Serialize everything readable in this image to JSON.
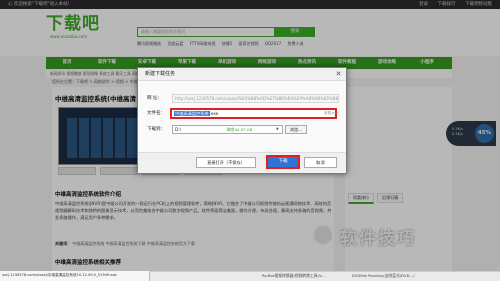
{
  "topbar": {
    "welcome": "心 欢迎搜索\"下载吧\"进入本站！",
    "links": [
      "登录",
      "下载排行",
      "下载吧移动版"
    ]
  },
  "logo": {
    "cn": "下载吧",
    "en": "www.xiazaiba.com"
  },
  "search": {
    "placeholder": "请输入需要搜索的关键词",
    "button": "搜索"
  },
  "hotwords": [
    "腾讯视频播放",
    "百度云盘",
    "FTTV网络电视",
    "快播5",
    "爱奇艺视频",
    "QQ2017",
    "免费小说"
  ],
  "nav": [
    "首页",
    "软件下载",
    "安卓下载",
    "苹果下载",
    "单机游戏",
    "网络游戏",
    "热点资讯",
    "软件教程",
    "游戏攻略",
    "小程序"
  ],
  "subnav": "新闻资讯  视频播放  图形图像  系统工具  聊天工具  网络工具  安全相关  游戏娱乐  手机软件",
  "breadcrumb": "您所在位置：下载吧 > 网络软件 > 视频 > 中维高清监控系统",
  "page": {
    "title": "中维高清监控系统(中维高清",
    "intro_heading": "中维高清监控系统软件介绍",
    "intro_text": "中维高清监控系统(JNVR)是中维公司开发的一款运行在PC机上的视频管理软件，简称JNVR。它融合了中维公司视频传输的云视通网络技术、高效的音视频编解码技术和独特的图像显示技术，从而完美结合中维公司数字视频产品，软件界面简洁美观，操作方便，布局合理，最高支持多路的音视频，并发多路操作，满足用户多种需求。",
    "keywords_label": "关键词：",
    "keywords": "中维高清监控系统  中维高清监控系统下载  中维高清监控系统官方下载",
    "more_heading": "中维高清监控系统相关推荐",
    "side_tabs": [
      "同类排行",
      "后续行情"
    ]
  },
  "net_widget": {
    "percent": "45%",
    "up": "0.3K/s",
    "down": "0.3K/s"
  },
  "dialog": {
    "title": "新建下载任务",
    "close_glyph": "✕",
    "url_label": "网  址：",
    "url_value": "http://xzcj.1230578.com/xiazai/%E4%B8%AD%E7%BB%B4%E9%AB%98%E6%B8%85%E7%9B%91%E6%8E%A7%E7%B3%BB%E7%BB%9F_10.12.09.0.exe",
    "filename_label": "文件名：",
    "filename_selected": "中维高清监控系统",
    "filename_ext": ".exe",
    "size_text": "未知大小",
    "dir_label": "下载到：",
    "dir_value": "D:\\",
    "free_space": "剩余44.07 GB",
    "dir_arrow": "▼",
    "browse": "浏览...",
    "open_directly": "直接打开（不保存）",
    "download": "下载",
    "cancel": "取消"
  },
  "statusbar": {
    "url": "xzcj.1230578.com/xiazai/中维高清监控系统10.12.09.0_51949.exe",
    "item2": "Ro.Bot视频转换器(视频转换工具)V...",
    "item3": "DVDFab Passkey(去除蓝光/DVD...)"
  },
  "watermark": "软件技巧"
}
